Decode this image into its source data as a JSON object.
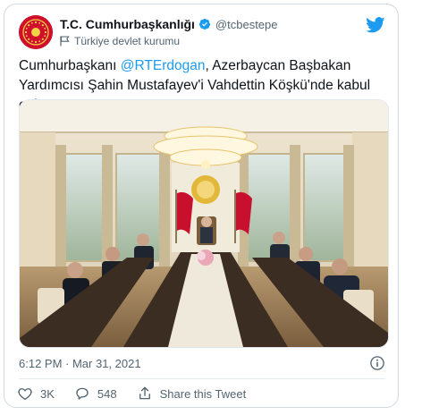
{
  "account": {
    "display_name": "T.C. Cumhurbaşkanlığı",
    "handle": "@tcbestepe",
    "label": "Türkiye devlet kurumu"
  },
  "tweet": {
    "prefix": "Cumhurbaşkanı ",
    "mention": "@RTErdogan",
    "suffix": ", Azerbaycan Başbakan Yardımcısı Şahin Mustafayev'i Vahdettin Köşkü'nde kabul etti."
  },
  "meta": {
    "timestamp": "6:12 PM · Mar 31, 2021"
  },
  "actions": {
    "likes": "3K",
    "replies": "548",
    "share_label": "Share this Tweet"
  },
  "icons": {
    "avatar": "presidential-seal-icon",
    "verified": "verified-badge-icon",
    "label": "government-flag-icon",
    "brand": "twitter-bird-icon",
    "info": "info-icon",
    "like": "heart-icon",
    "reply": "reply-icon",
    "share": "share-icon"
  },
  "colors": {
    "accent": "#1d9bf0",
    "seal_red": "#d0102a",
    "muted": "#536471"
  }
}
